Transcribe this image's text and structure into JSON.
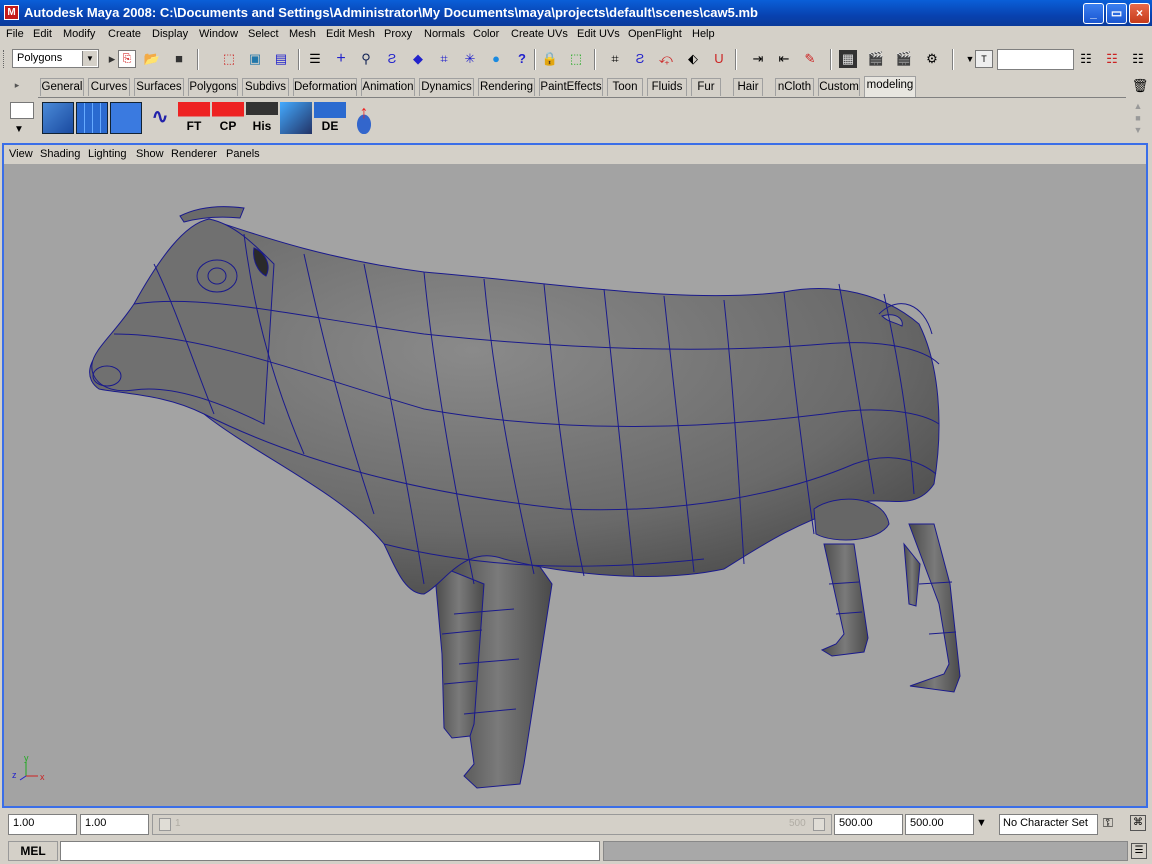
{
  "window": {
    "title": "Autodesk Maya 2008: C:\\Documents and Settings\\Administrator\\My Documents\\maya\\projects\\default\\scenes\\caw5.mb",
    "minimize_label": "_",
    "maximize_label": "▭",
    "close_label": "×"
  },
  "menubar": [
    "File",
    "Edit",
    "Modify",
    "Create",
    "Display",
    "Window",
    "Select",
    "Mesh",
    "Edit Mesh",
    "Proxy",
    "Normals",
    "Color",
    "Create UVs",
    "Edit UVs",
    "OpenFlight",
    "Help"
  ],
  "status_line": {
    "menu_set": "Polygons",
    "search_value": ""
  },
  "shelf": {
    "tabs": [
      "General",
      "Curves",
      "Surfaces",
      "Polygons",
      "Subdivs",
      "Deformation",
      "Animation",
      "Dynamics",
      "Rendering",
      "PaintEffects",
      "Toon",
      "Fluids",
      "Fur",
      "Hair",
      "nCloth",
      "Custom",
      "modeling"
    ],
    "active_tab": "modeling",
    "buttons": [
      {
        "name": "poly-cube",
        "label": ""
      },
      {
        "name": "poly-plane",
        "label": ""
      },
      {
        "name": "select-tool",
        "label": ""
      },
      {
        "name": "cv-curve",
        "label": ""
      },
      {
        "name": "ft",
        "label": "FT"
      },
      {
        "name": "cp",
        "label": "CP"
      },
      {
        "name": "his",
        "label": "His"
      },
      {
        "name": "uv-editor",
        "label": ""
      },
      {
        "name": "de",
        "label": "DE"
      },
      {
        "name": "move-up",
        "label": ""
      }
    ]
  },
  "panel": {
    "menus": [
      "View",
      "Shading",
      "Lighting",
      "Show",
      "Renderer",
      "Panels"
    ],
    "axis": {
      "x": "x",
      "y": "y",
      "z": "z"
    }
  },
  "range": {
    "start_time": "1.00",
    "start_range": "1.00",
    "slider_value": "1",
    "slider_end_label": "500",
    "end_range": "500.00",
    "end_time": "500.00",
    "character_set": "No Character Set"
  },
  "command_line": {
    "language": "MEL",
    "value": ""
  },
  "colors": {
    "title_bar": "#0842b0",
    "viewport_bg": "#a3a3a3",
    "wire": "#1a1a8c",
    "panel_border": "#3a6ee8"
  }
}
